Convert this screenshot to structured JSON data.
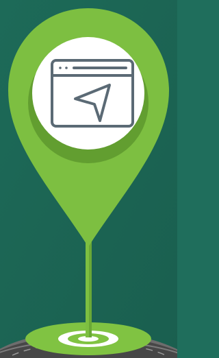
{
  "illustration": {
    "kind": "location-pin-marker",
    "icon": "browser-window-navigation-arrow-icon",
    "colors": {
      "background": "#1f6e5c",
      "background_dark": "#195a4b",
      "pin_green": "#7dbf41",
      "pin_shadow_green": "#5f9a2f",
      "inner_circle": "#ffffff",
      "icon_stroke": "#5b6a75",
      "road": "#4a4a4a",
      "road_edge": "#6d6d6d",
      "ground_ring_green": "#80c342",
      "ground_ring_white": "#ffffff"
    }
  }
}
